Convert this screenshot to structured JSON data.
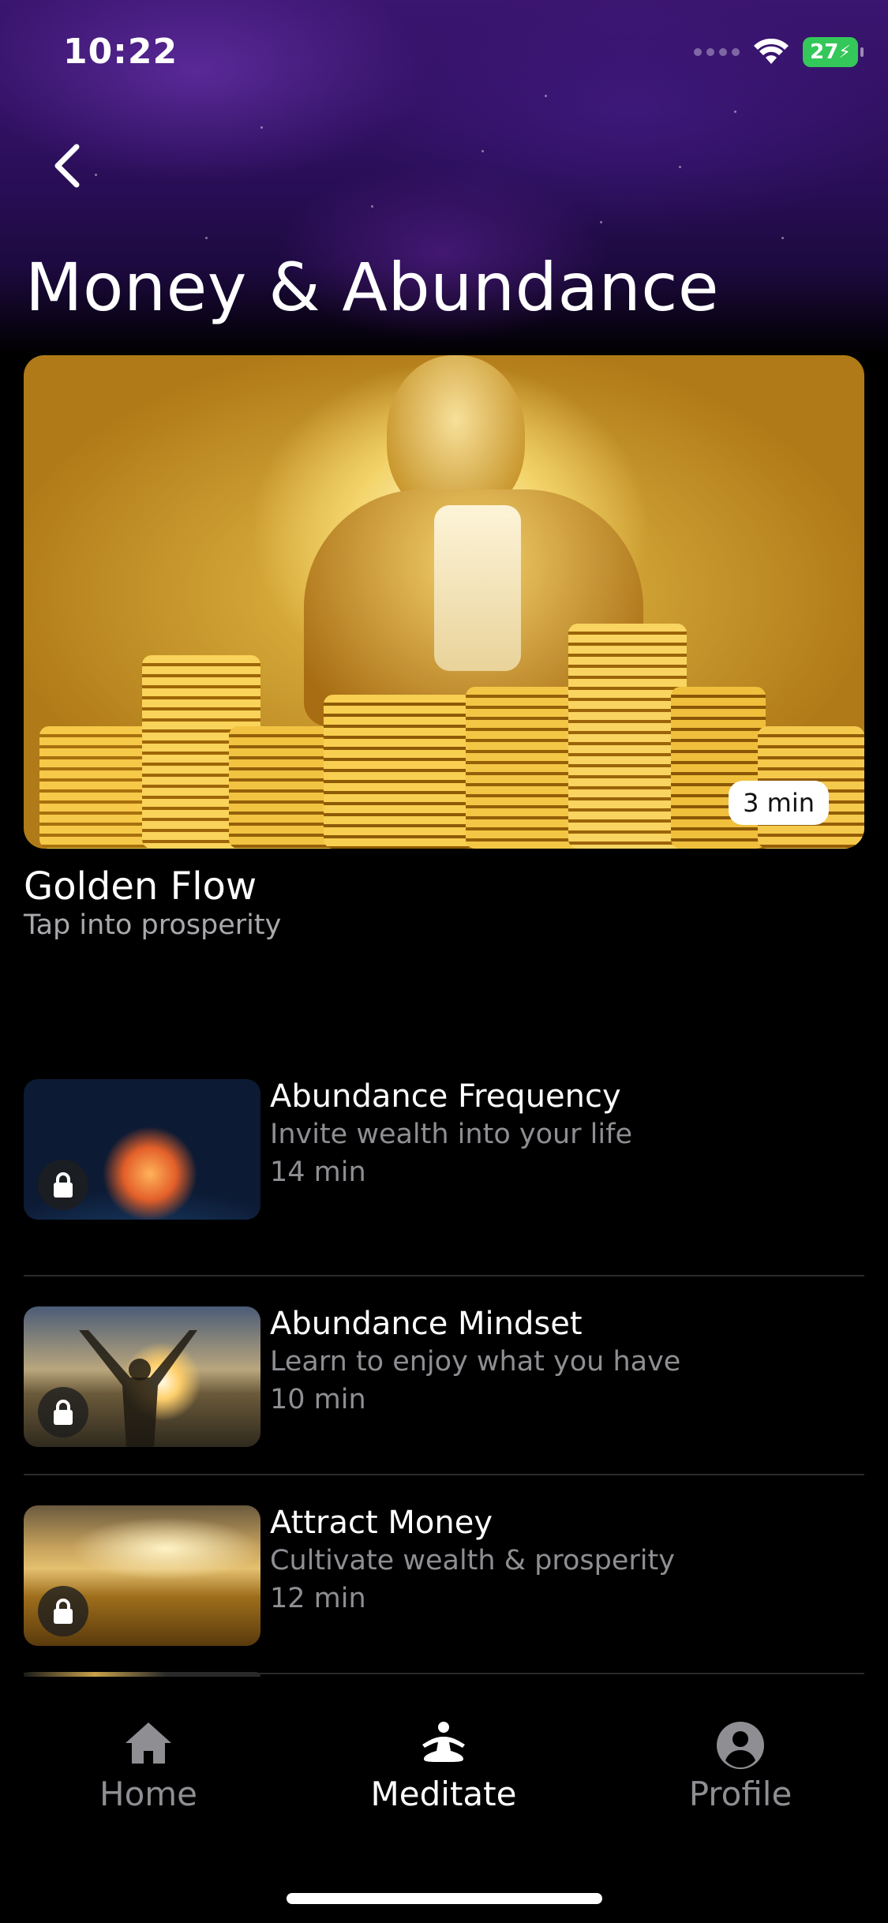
{
  "status_bar": {
    "time": "10:22",
    "battery": "27",
    "icons": [
      "cellular-dots-icon",
      "wifi-icon",
      "battery-charging-icon"
    ]
  },
  "header": {
    "back_icon": "chevron-left-icon",
    "title": "Money & Abundance"
  },
  "featured": {
    "title": "Golden Flow",
    "subtitle": "Tap into prosperity",
    "duration": "3 min"
  },
  "meditations": [
    {
      "title": "Abundance Frequency",
      "subtitle": "Invite wealth into your life",
      "duration": "14 min",
      "locked": true
    },
    {
      "title": "Abundance Mindset",
      "subtitle": "Learn to enjoy what you have",
      "duration": "10 min",
      "locked": true
    },
    {
      "title": "Attract Money",
      "subtitle": "Cultivate wealth & prosperity",
      "duration": "12 min",
      "locked": true
    }
  ],
  "tabbar": {
    "home": "Home",
    "meditate": "Meditate",
    "profile": "Profile",
    "active": "meditate"
  },
  "colors": {
    "header_purple": "#3b1570",
    "background": "#000000",
    "secondary_text": "#8e8e93",
    "battery_green": "#34c759"
  }
}
